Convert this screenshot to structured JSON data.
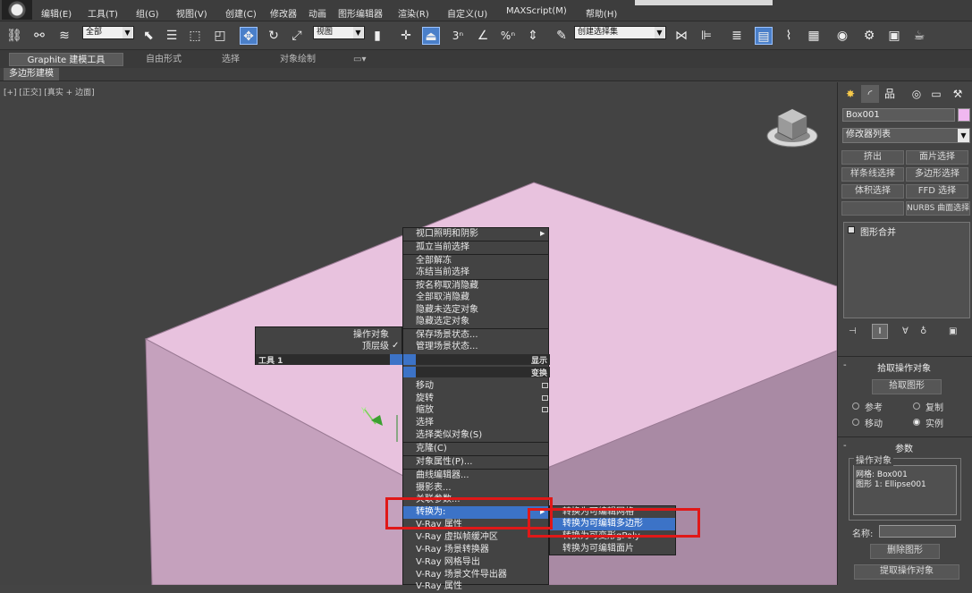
{
  "menubar": {
    "items": [
      "编辑(E)",
      "工具(T)",
      "组(G)",
      "视图(V)",
      "创建(C)",
      "修改器",
      "动画",
      "图形编辑器",
      "渲染(R)",
      "自定义(U)",
      "MAXScript(M)",
      "帮助(H)"
    ]
  },
  "toolbar": {
    "filter_value": "全部",
    "refcoord_value": "视图",
    "selset_value": "创建选择集",
    "angle_snap_label": "3",
    "percent_snap_label": "%"
  },
  "ribbon": {
    "tabs": [
      "Graphite 建模工具",
      "自由形式",
      "选择",
      "对象绘制"
    ],
    "subtab": "多边形建模"
  },
  "viewport": {
    "label": "[+] [正交] [真实 + 边面]"
  },
  "quad_left": {
    "items": [
      "操作对象",
      "顶层级"
    ],
    "tools_label": "工具 1",
    "check": "✓"
  },
  "quad_right": {
    "headers": [
      "显示",
      "变换"
    ],
    "display_items": [
      "视口照明和阴影",
      "孤立当前选择",
      "全部解冻",
      "冻结当前选择",
      "按名称取消隐藏",
      "全部取消隐藏",
      "隐藏未选定对象",
      "隐藏选定对象",
      "保存场景状态...",
      "管理场景状态..."
    ],
    "transform_items": [
      "移动",
      "旋转",
      "缩放",
      "选择",
      "选择类似对象(S)",
      "克隆(C)",
      "对象属性(P)...",
      "曲线编辑器...",
      "摄影表...",
      "关联参数...",
      "转换为:",
      "V-Ray 属性",
      "V-Ray 虚拟帧缓冲区",
      "V-Ray 场景转换器",
      "V-Ray 网格导出",
      "V-Ray 场景文件导出器",
      "V-Ray 属性"
    ]
  },
  "convert_submenu": {
    "items": [
      "转换为可编辑网格",
      "转换为可编辑多边形",
      "转换为可变形gPoly",
      "转换为可编辑面片"
    ]
  },
  "cmdpanel": {
    "object_name": "Box001",
    "object_color": "#f0b8f0",
    "modifier_list": "修改器列表",
    "mod_buttons": [
      "挤出",
      "面片选择",
      "样条线选择",
      "多边形选择",
      "体积选择",
      "FFD 选择",
      "",
      "NURBS 曲面选择"
    ],
    "stack_item": "图形合并",
    "pick_rollout": "拾取操作对象",
    "pick_button": "拾取图形",
    "radio_ref": "参考",
    "radio_copy": "复制",
    "radio_move": "移动",
    "radio_instance": "实例",
    "params_rollout": "参数",
    "operands_label": "操作对象",
    "operands": [
      "网格: Box001",
      "图形 1: Ellipse001"
    ],
    "name_label": "名称:",
    "delete_button": "删除图形",
    "extract_button": "提取操作对象"
  },
  "colors": {
    "box_top": "#e8c2de",
    "box_front": "#c5a1bd",
    "box_side": "#a98aa4",
    "highlight": "#3c73c7",
    "callout": "#e01818"
  }
}
